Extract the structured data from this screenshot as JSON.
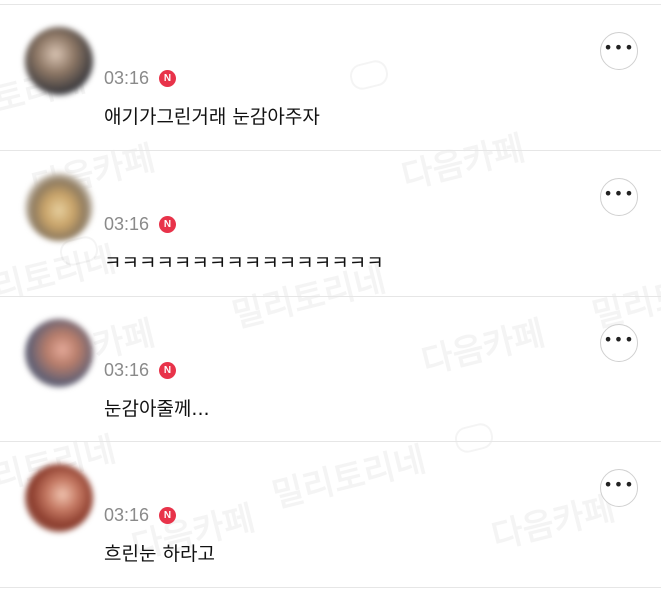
{
  "watermark": {
    "text_a": "다음카페",
    "text_b": "밀리토리네"
  },
  "badge_label": "N",
  "more_icon": "more-horizontal-icon",
  "colors": {
    "badge": "#e8334a",
    "time": "#8a8a8a",
    "divider": "#e6e6e6"
  },
  "comments": [
    {
      "time": "03:16",
      "text": "애기가그린거래 눈감아주자"
    },
    {
      "time": "03:16",
      "text": "ㅋㅋㅋㅋㅋㅋㅋㅋㅋㅋㅋㅋㅋㅋㅋㅋ"
    },
    {
      "time": "03:16",
      "text": "눈감아줄께..."
    },
    {
      "time": "03:16",
      "text": "흐린눈 하라고"
    }
  ]
}
